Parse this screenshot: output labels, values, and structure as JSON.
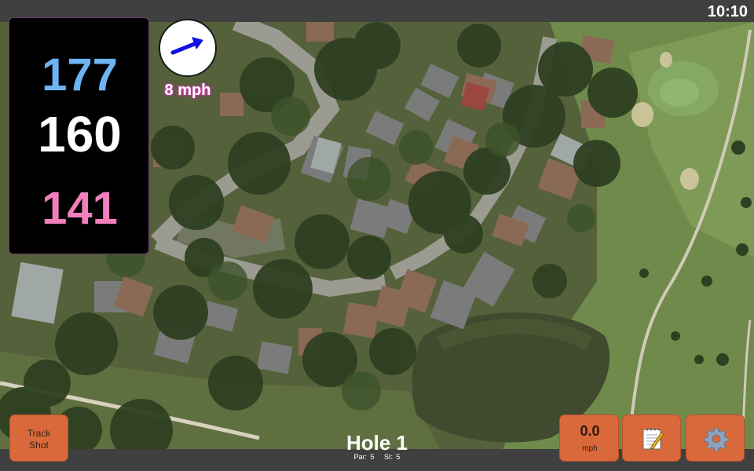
{
  "status_bar": {
    "time": "10:10"
  },
  "distances": {
    "back": "177",
    "center": "160",
    "front": "141"
  },
  "wind": {
    "speed_label": "8 mph",
    "direction_icon": "arrow-up-right-icon"
  },
  "hole": {
    "title": "Hole 1",
    "par_label": "Par: 5",
    "si_label": "SI: 5"
  },
  "buttons": {
    "track_shot_line1": "Track",
    "track_shot_line2": "Shot",
    "speed_value": "0.0",
    "speed_unit": "mph",
    "notes_icon": "notepad-icon",
    "settings_icon": "gear-icon"
  },
  "colors": {
    "distance_back": "#6cb4f2",
    "distance_center": "#ffffff",
    "distance_front": "#f27fbd",
    "button_orange": "#d9693a",
    "wind_label_glow": "#d63fb4"
  }
}
